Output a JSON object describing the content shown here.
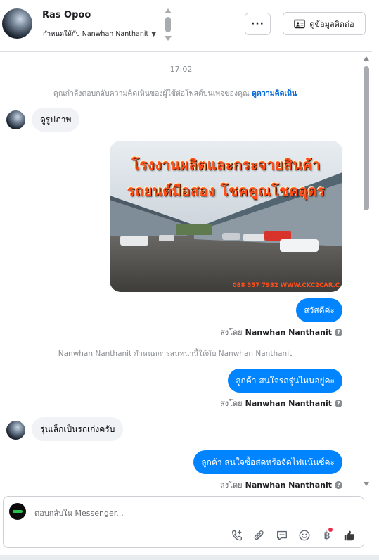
{
  "header": {
    "contact_name": "Ras Opoo",
    "assigned_label": "กำหนดให้กับ Nanwhan Nanthanit",
    "more_label": "···",
    "view_contact_label": "ดูข้อมูลติดต่อ"
  },
  "thread": {
    "timestamp": "17:02",
    "reply_notice": "คุณกำลังตอบกลับความคิดเห็นของผู้ใช้ต่อโพสต์บนเพจของคุณ",
    "reply_notice_link": "ดูความคิดเห็น",
    "incoming_1": "ดูรูปภาพ",
    "image": {
      "line1": "โรงงานผลิตและกระจายสินค้า",
      "line2": "รถยนต์มือสอง โชคคูณโชคอุดร",
      "footer": "088 557 7932 WWW.CKC2CAR.C"
    },
    "outgoing_1": "สวัสดีค่ะ",
    "sent_by_label": "ส่งโดย",
    "sender": "Nanwhan Nanthanit",
    "assign_notice": "Nanwhan Nanthanit กำหนดการสนทนานี้ให้กับ Nanwhan Nanthanit",
    "outgoing_2": "ลูกค้า สนใจรถรุ่นไหนอยู่คะ",
    "incoming_2": "รุ่นเล็กเป็นรถเก๋งครับ",
    "outgoing_3": "ลูกค้า สนใจซื้อสดหรือจัดไฟแน้นซ์คะ"
  },
  "composer": {
    "placeholder": "ตอบกลับใน Messenger...",
    "currency_symbol": "฿"
  },
  "icons": {
    "call": "phone-plus-icon",
    "attach": "paperclip-icon",
    "saved_reply": "chat-bubble-icon",
    "emoji": "smiley-icon",
    "payment": "baht-icon",
    "like": "thumbs-up-icon"
  },
  "colors": {
    "outgoing_bubble": "#0084ff",
    "incoming_bubble": "#f0f2f5",
    "link": "#0a6ad6",
    "notification_dot": "#f02849"
  }
}
